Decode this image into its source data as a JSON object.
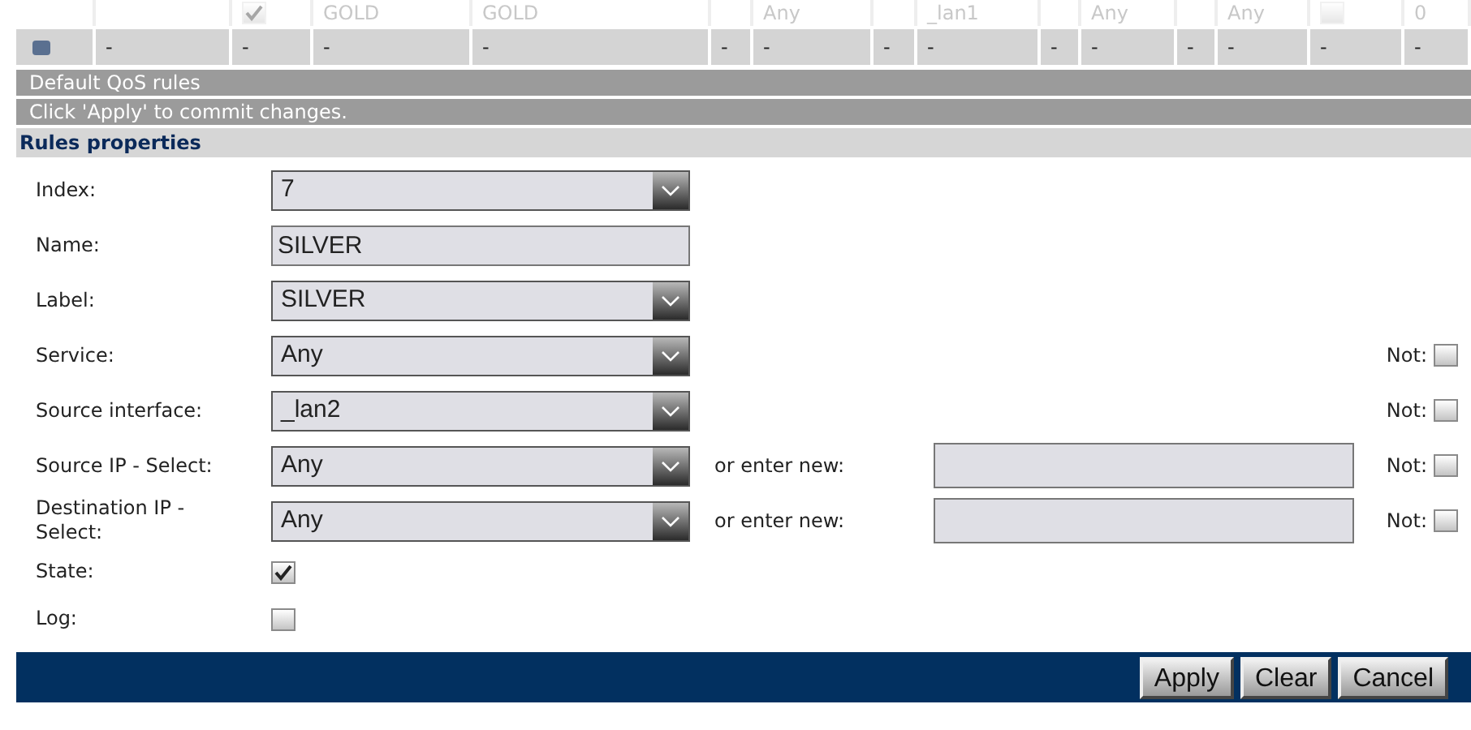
{
  "table": {
    "rows": [
      {
        "faded": true,
        "cells": [
          {
            "kind": "empty"
          },
          {
            "kind": "empty"
          },
          {
            "kind": "checkbox",
            "checked": true
          },
          {
            "kind": "text",
            "text": "GOLD"
          },
          {
            "kind": "text",
            "text": "GOLD"
          },
          {
            "kind": "empty"
          },
          {
            "kind": "text",
            "text": "Any"
          },
          {
            "kind": "empty"
          },
          {
            "kind": "text",
            "text": "_lan1"
          },
          {
            "kind": "empty"
          },
          {
            "kind": "text",
            "text": "Any"
          },
          {
            "kind": "empty"
          },
          {
            "kind": "text",
            "text": "Any"
          },
          {
            "kind": "checkbox",
            "checked": false
          },
          {
            "kind": "text",
            "text": "0"
          }
        ]
      },
      {
        "faded": false,
        "cells": [
          {
            "kind": "dot"
          },
          {
            "kind": "text",
            "text": "-"
          },
          {
            "kind": "text",
            "text": "-"
          },
          {
            "kind": "text",
            "text": "-"
          },
          {
            "kind": "text",
            "text": "-"
          },
          {
            "kind": "text",
            "text": "-"
          },
          {
            "kind": "text",
            "text": "-"
          },
          {
            "kind": "text",
            "text": "-"
          },
          {
            "kind": "text",
            "text": "-"
          },
          {
            "kind": "text",
            "text": "-"
          },
          {
            "kind": "text",
            "text": "-"
          },
          {
            "kind": "text",
            "text": "-"
          },
          {
            "kind": "text",
            "text": "-"
          },
          {
            "kind": "text",
            "text": "-"
          },
          {
            "kind": "text",
            "text": "-"
          }
        ]
      }
    ]
  },
  "info_bars": [
    "Default QoS rules",
    "Click 'Apply' to commit changes."
  ],
  "section_title": "Rules properties",
  "fields": [
    {
      "kind": "select",
      "label": "Index:",
      "value": "7"
    },
    {
      "kind": "text",
      "label": "Name:",
      "value": "SILVER"
    },
    {
      "kind": "select",
      "label": "Label:",
      "value": "SILVER"
    },
    {
      "kind": "select",
      "label": "Service:",
      "value": "Any",
      "not": {
        "label": "Not:",
        "checked": false
      }
    },
    {
      "kind": "select",
      "label": "Source interface:",
      "value": "_lan2",
      "not": {
        "label": "Not:",
        "checked": false
      }
    },
    {
      "kind": "select",
      "label": "Source IP - Select:",
      "value": "Any",
      "alt_input": {
        "label": "or enter new:"
      },
      "not": {
        "label": "Not:",
        "checked": false
      }
    },
    {
      "kind": "select",
      "label": "Destination IP - Select:",
      "value": "Any",
      "alt_input": {
        "label": "or enter new:"
      },
      "not": {
        "label": "Not:",
        "checked": false
      }
    },
    {
      "kind": "checkbox",
      "label": "State:",
      "checked": true
    },
    {
      "kind": "checkbox",
      "label": "Log:",
      "checked": false
    }
  ],
  "buttons": [
    "Apply",
    "Clear",
    "Cancel"
  ]
}
